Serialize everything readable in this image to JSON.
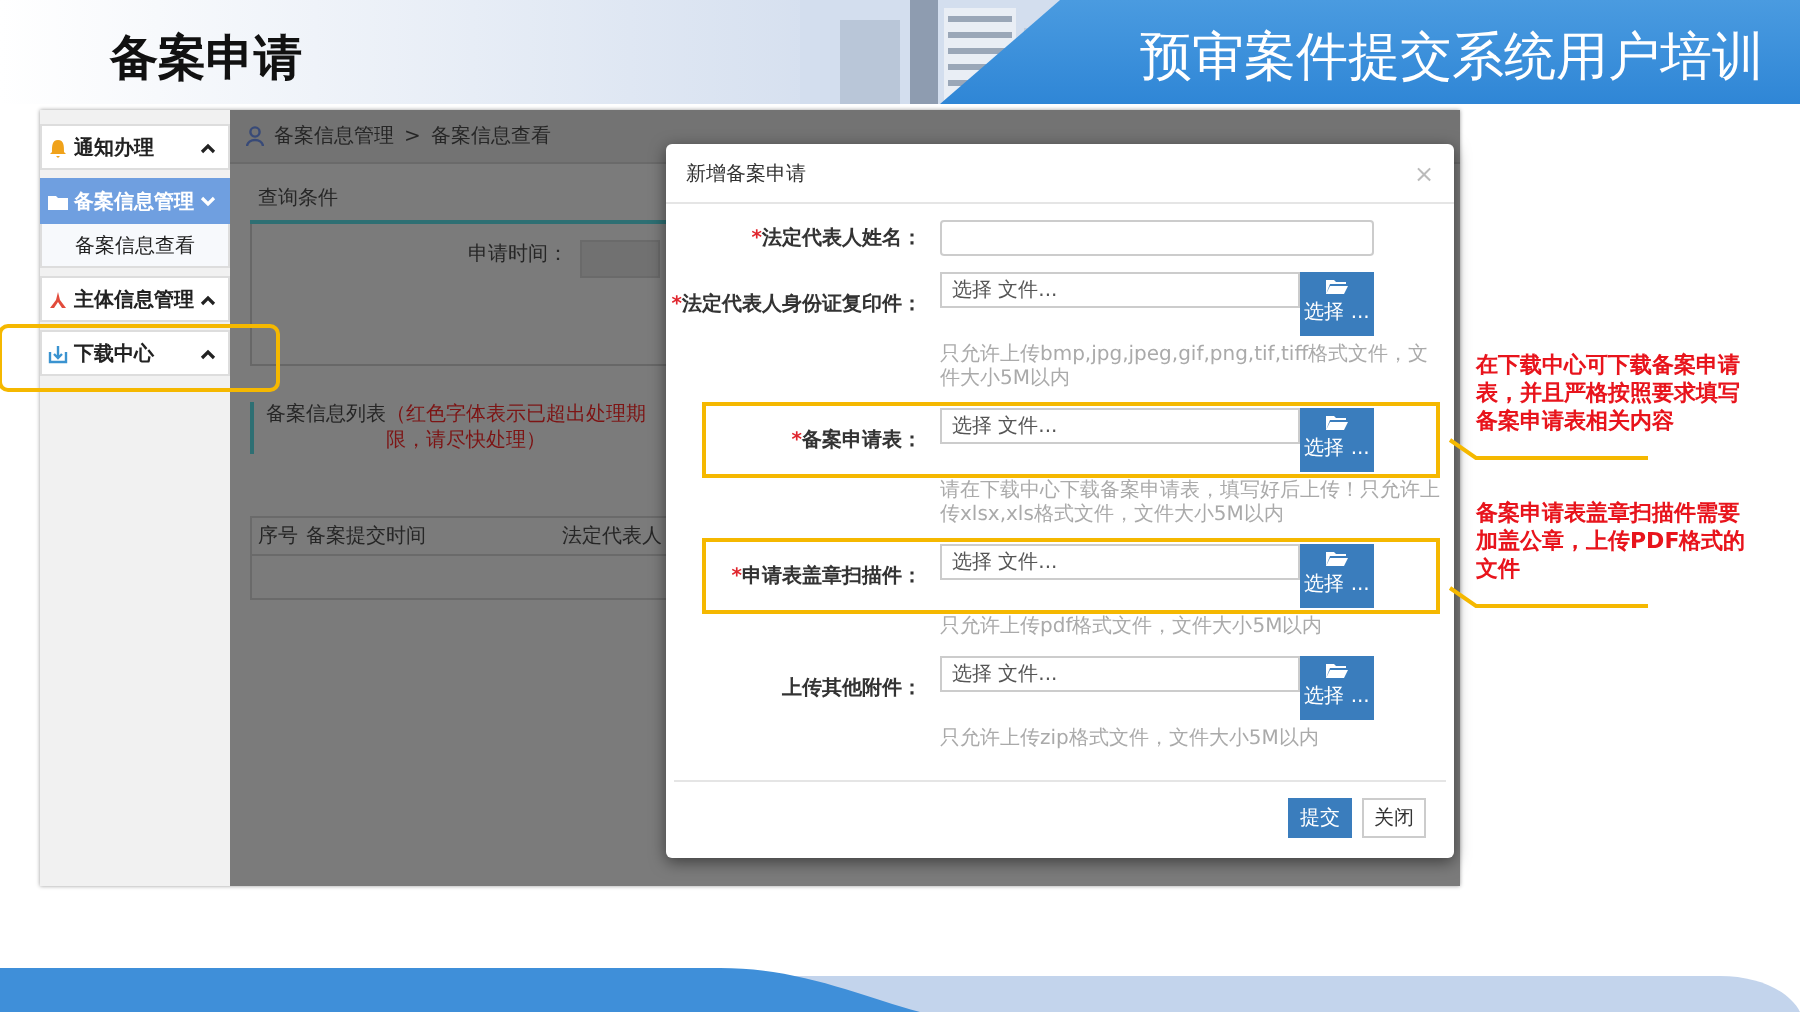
{
  "slide": {
    "title": "备案申请",
    "banner": "预审案件提交系统用户培训"
  },
  "sidebar": {
    "items": [
      {
        "label": "通知办理",
        "selected": false,
        "expanded": false,
        "highlighted": false
      },
      {
        "label": "备案信息管理",
        "selected": true,
        "expanded": true,
        "highlighted": false,
        "children": [
          {
            "label": "备案信息查看"
          }
        ]
      },
      {
        "label": "主体信息管理",
        "selected": false,
        "expanded": false,
        "highlighted": false
      },
      {
        "label": "下载中心",
        "selected": false,
        "expanded": false,
        "highlighted": true
      }
    ]
  },
  "breadcrumb": {
    "items": [
      "备案信息管理",
      "备案信息查看"
    ],
    "separator": ">"
  },
  "query_panel": {
    "title": "查询条件",
    "fields": [
      {
        "label": "申请时间："
      }
    ]
  },
  "list": {
    "title": "备案信息列表",
    "note": "（红色字体表示已超出处理期限，请尽快处理）",
    "columns": [
      "序号",
      "备案提交时间",
      "法定代表人"
    ]
  },
  "dialog": {
    "title": "新增备案申请",
    "close": "×",
    "fields": [
      {
        "kind": "text",
        "marker": "*",
        "label": "法定代表人姓名：",
        "highlighted": false
      },
      {
        "kind": "file",
        "marker": "*",
        "label": "法定代表人身份证复印件：",
        "placeholder": "选择 文件...",
        "button": "选择 ...",
        "hint": "只允许上传bmp,jpg,jpeg,gif,png,tif,tiff格式文件，文件大小5M以内",
        "highlighted": false
      },
      {
        "kind": "file",
        "marker": "*",
        "label": "备案申请表：",
        "placeholder": "选择 文件...",
        "button": "选择 ...",
        "hint": "请在下载中心下载备案申请表，填写好后上传！只允许上传xlsx,xls格式文件，文件大小5M以内",
        "highlighted": true
      },
      {
        "kind": "file",
        "marker": "*",
        "label": "申请表盖章扫描件：",
        "placeholder": "选择 文件...",
        "button": "选择 ...",
        "hint": "只允许上传pdf格式文件，文件大小5M以内",
        "highlighted": true
      },
      {
        "kind": "file",
        "label": "上传其他附件：",
        "placeholder": "选择 文件...",
        "button": "选择 ...",
        "hint": "只允许上传zip格式文件，文件大小5M以内",
        "highlighted": false
      }
    ],
    "buttons": [
      {
        "label": "提交",
        "kind": "primary"
      },
      {
        "label": "关闭",
        "kind": "default"
      }
    ]
  },
  "callouts": [
    {
      "text": "在下载中心可下载备案申请表，并且严格按照要求填写备案申请表相关内容"
    },
    {
      "text": "备案申请表盖章扫描件需要加盖公章，上传PDF格式的文件"
    }
  ]
}
